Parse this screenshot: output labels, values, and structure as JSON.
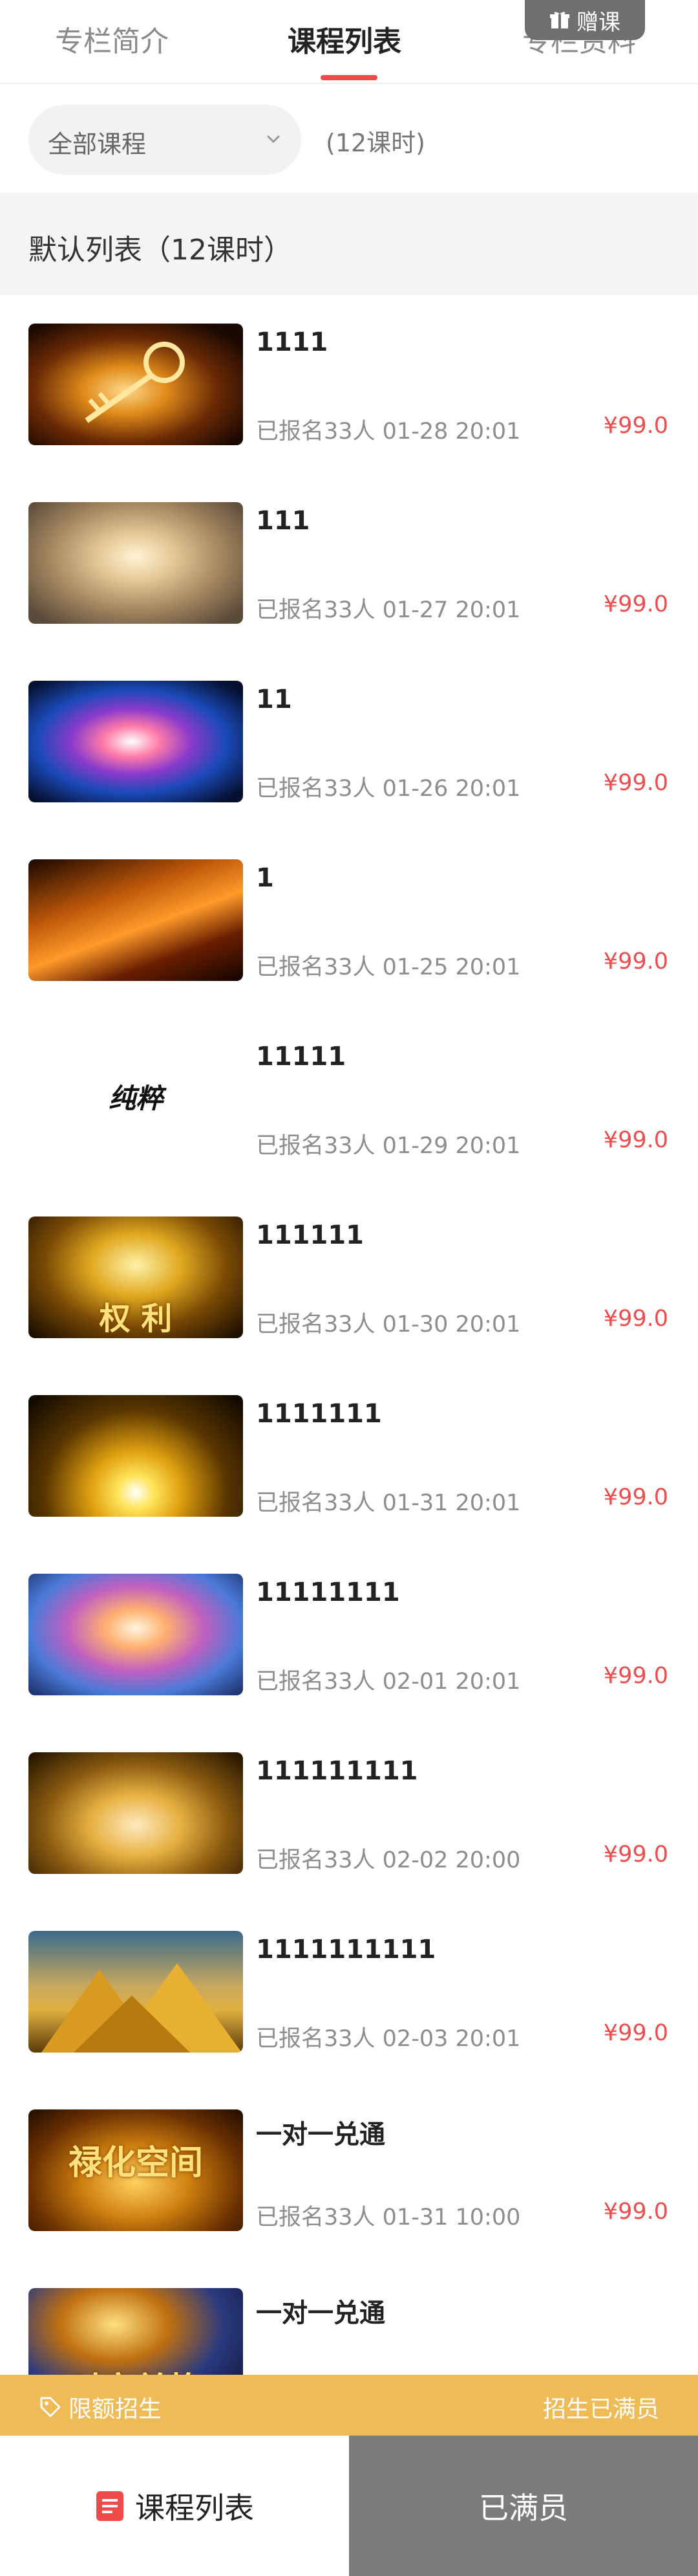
{
  "tabs": [
    {
      "label": "专栏简介"
    },
    {
      "label": "课程列表"
    },
    {
      "label": "专栏资料"
    }
  ],
  "gift_badge": {
    "label": "赠课",
    "icon": "gift-icon"
  },
  "filter": {
    "dropdown_label": "全部课程",
    "lesson_count": "(12课时)"
  },
  "section": {
    "title": "默认列表（12课时）"
  },
  "courses": [
    {
      "title": "1111",
      "meta": "已报名33人  01-28 20:01",
      "price": "¥99.0",
      "thumb": "golden-key"
    },
    {
      "title": "111",
      "meta": "已报名33人  01-27 20:01",
      "price": "¥99.0",
      "thumb": "light-swirl"
    },
    {
      "title": "11",
      "meta": "已报名33人  01-26 20:01",
      "price": "¥99.0",
      "thumb": "energy-orb"
    },
    {
      "title": "1",
      "meta": "已报名33人  01-25 20:01",
      "price": "¥99.0",
      "thumb": "fire-sparks"
    },
    {
      "title": "11111",
      "meta": "已报名33人  01-29 20:01",
      "price": "¥99.0",
      "thumb": "calligraphy",
      "thumb_text": "纯粹"
    },
    {
      "title": "111111",
      "meta": "已报名33人  01-30 20:01",
      "price": "¥99.0",
      "thumb": "golden-fist",
      "thumb_text": "权 利"
    },
    {
      "title": "1111111",
      "meta": "已报名33人  01-31 20:01",
      "price": "¥99.0",
      "thumb": "golden-rays"
    },
    {
      "title": "11111111",
      "meta": "已报名33人  02-01 20:01",
      "price": "¥99.0",
      "thumb": "goddess-light"
    },
    {
      "title": "111111111",
      "meta": "已报名33人  02-02 20:00",
      "price": "¥99.0",
      "thumb": "wealth-pig"
    },
    {
      "title": "1111111111",
      "meta": "已报名33人  02-03 20:01",
      "price": "¥99.0",
      "thumb": "golden-mountains"
    },
    {
      "title": "一对一兑通",
      "meta": "已报名33人  01-31 10:00",
      "price": "¥99.0",
      "thumb": "wealth-space",
      "thumb_text": "禄化空间"
    },
    {
      "title": "一对一兑通",
      "meta": "",
      "price": "",
      "thumb": "time-space",
      "thumb_text": "时空兑换"
    }
  ],
  "enroll_bar": {
    "left_label": "限额招生",
    "right_label": "招生已满员",
    "icon": "tag-icon"
  },
  "bottom": {
    "list_label": "课程列表",
    "full_label": "已满员",
    "icon": "doc-icon"
  },
  "colors": {
    "accent": "#f04a4a",
    "gold": "#efbb56",
    "gray_button": "#7c7c7c"
  }
}
